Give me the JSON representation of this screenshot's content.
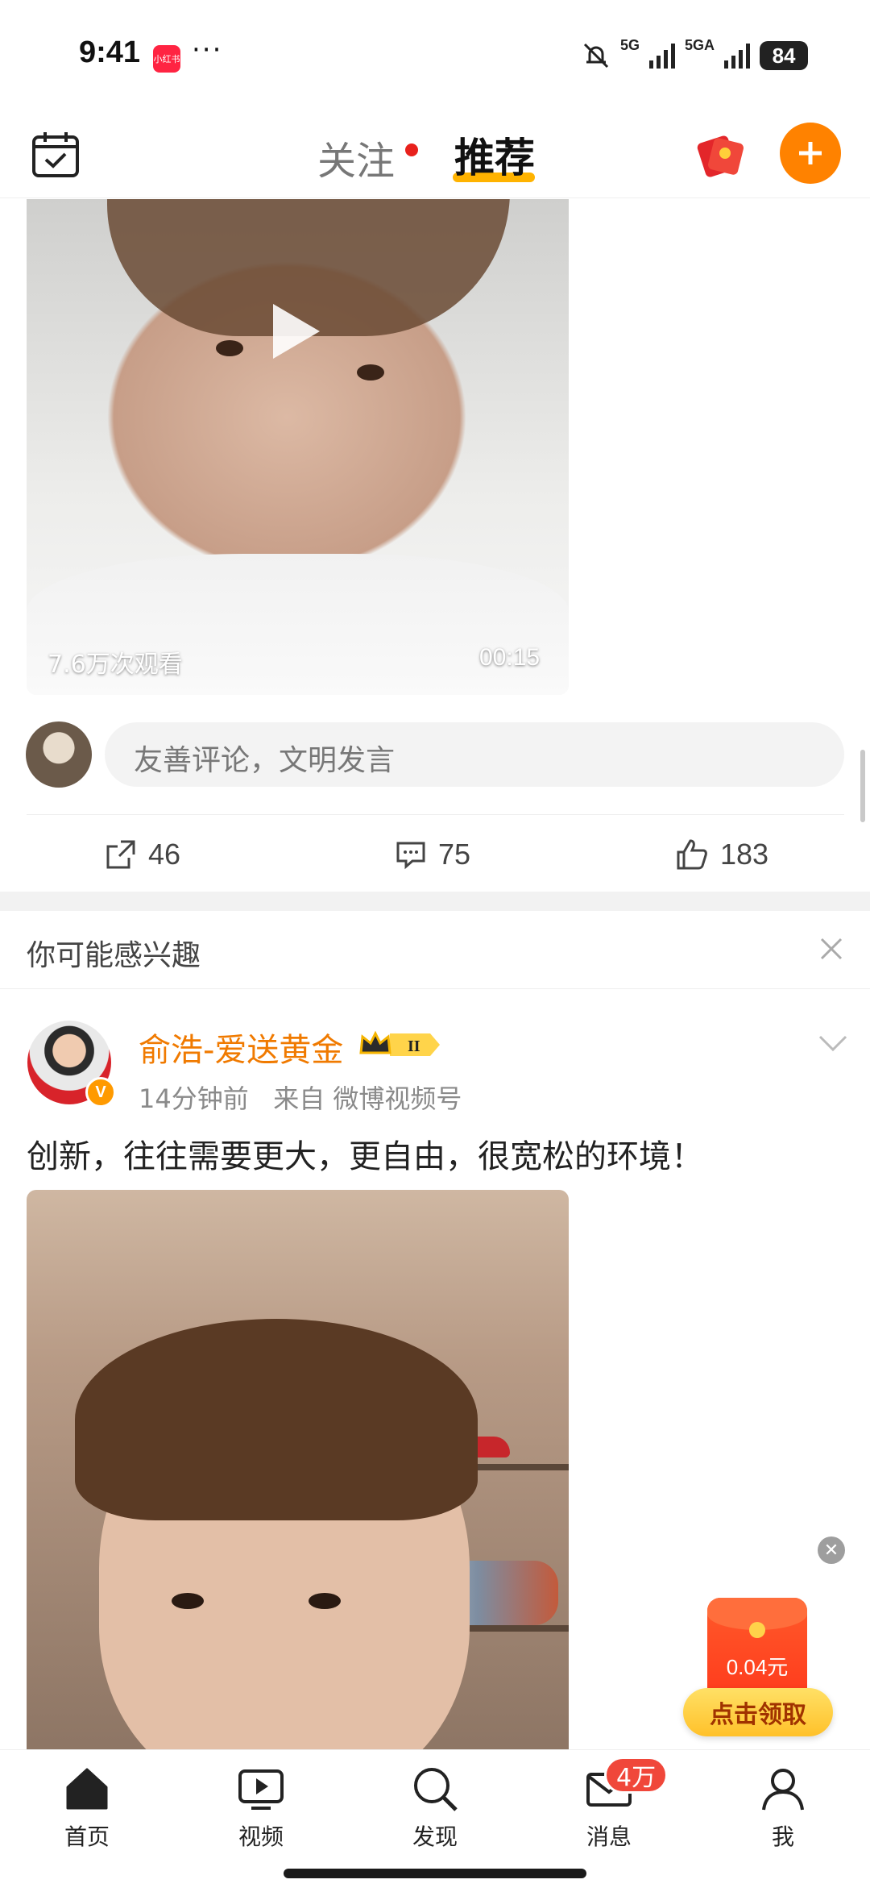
{
  "status_bar": {
    "time": "9:41",
    "app_badge": "小红书",
    "dots": "···",
    "signal1": "5G",
    "signal2": "5GA",
    "battery": "84"
  },
  "header": {
    "tab_follow": "关注",
    "tab_recommend": "推荐",
    "active_tab": "推荐",
    "accent_color": "#ff8200"
  },
  "video_post": {
    "views": "7.6万次观看",
    "duration": "00:15",
    "comment_placeholder": "友善评论，文明发言",
    "reposts": "46",
    "comments": "75",
    "likes": "183"
  },
  "interest_section": {
    "title": "你可能感兴趣"
  },
  "post": {
    "author": "俞浩-爱送黄金",
    "vip_level": "II",
    "verified_mark": "V",
    "time": "14分钟前",
    "source": "来自 微博视频号",
    "text": "创新，往往需要更大，更自由，很宽松的环境！"
  },
  "reward": {
    "amount": "0.04元",
    "claim_label": "点击领取"
  },
  "bottom_nav": {
    "items": [
      {
        "label": "首页",
        "icon": "home-icon"
      },
      {
        "label": "视频",
        "icon": "video-icon"
      },
      {
        "label": "发现",
        "icon": "search-icon"
      },
      {
        "label": "消息",
        "icon": "mail-icon"
      },
      {
        "label": "我",
        "icon": "profile-icon"
      }
    ],
    "message_badge": "4万"
  }
}
